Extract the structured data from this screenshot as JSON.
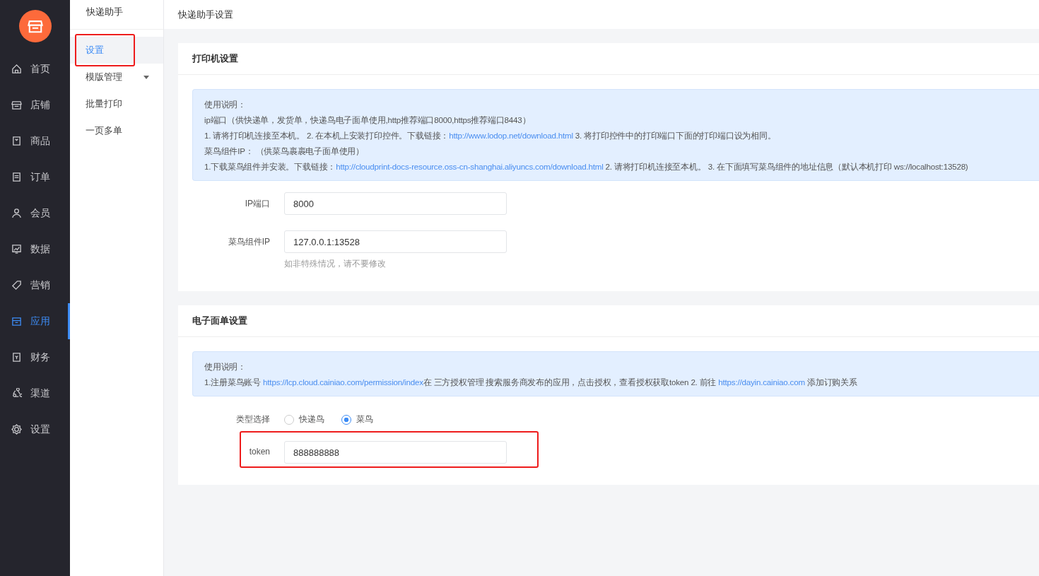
{
  "nav": [
    {
      "label": "首页",
      "selected": false
    },
    {
      "label": "店铺",
      "selected": false
    },
    {
      "label": "商品",
      "selected": false
    },
    {
      "label": "订单",
      "selected": false
    },
    {
      "label": "会员",
      "selected": false
    },
    {
      "label": "数据",
      "selected": false
    },
    {
      "label": "营销",
      "selected": false
    },
    {
      "label": "应用",
      "selected": true
    },
    {
      "label": "财务",
      "selected": false
    },
    {
      "label": "渠道",
      "selected": false
    },
    {
      "label": "设置",
      "selected": false
    }
  ],
  "submenu": {
    "title": "快递助手",
    "items": [
      {
        "label": "设置",
        "selected": true,
        "highlighted": true,
        "dropdown": false
      },
      {
        "label": "模版管理",
        "selected": false,
        "highlighted": false,
        "dropdown": true
      },
      {
        "label": "批量打印",
        "selected": false,
        "highlighted": false,
        "dropdown": false
      },
      {
        "label": "一页多单",
        "selected": false,
        "highlighted": false,
        "dropdown": false
      }
    ]
  },
  "page_title": "快递助手设置",
  "sections": [
    {
      "title": "打印机设置",
      "notes": [
        [
          {
            "text": "使用说明："
          }
        ],
        [
          {
            "text": "ip端口（供快递单，发货单，快递鸟电子面单使用,http推荐端口8000,https推荐端口8443）"
          }
        ],
        [
          {
            "text": "1. 请将打印机连接至本机。 2. 在本机上安装打印控件。下载链接："
          },
          {
            "text": "http://www.lodop.net/download.html",
            "link": true
          },
          {
            "text": " 3. 将打印控件中的打印端口下面的打印端口设为相同。"
          }
        ],
        [
          {
            "text": "菜鸟组件IP： （供菜鸟裹裹电子面单使用）"
          }
        ],
        [
          {
            "text": "1.下载菜鸟组件并安装。下载链接："
          },
          {
            "text": "http://cloudprint-docs-resource.oss-cn-shanghai.aliyuncs.com/download.html",
            "link": true
          },
          {
            "text": " 2. 请将打印机连接至本机。 3. 在下面填写菜鸟组件的地址信息（默认本机打印 ws://localhost:13528)"
          }
        ]
      ],
      "fields": [
        {
          "kind": "input",
          "label": "IP端口",
          "value": "8000",
          "highlighted": false
        },
        {
          "kind": "input",
          "label": "菜鸟组件IP",
          "value": "127.0.0.1:13528",
          "hint": "如非特殊情况，请不要修改",
          "highlighted": false
        }
      ]
    },
    {
      "title": "电子面单设置",
      "notes": [
        [
          {
            "text": "使用说明："
          }
        ],
        [
          {
            "text": "1.注册菜鸟账号 "
          },
          {
            "text": "https://lcp.cloud.cainiao.com/permission/index",
            "link": true
          },
          {
            "text": "在 三方授权管理 搜索服务商发布的应用，点击授权，查看授权获取token 2. 前往 "
          },
          {
            "text": "https://dayin.cainiao.com",
            "link": true
          },
          {
            "text": " 添加订购关系"
          }
        ]
      ],
      "fields": [
        {
          "kind": "radio",
          "label": "类型选择",
          "options": [
            {
              "label": "快递鸟",
              "selected": false
            },
            {
              "label": "菜鸟",
              "selected": true
            }
          ],
          "highlighted": false
        },
        {
          "kind": "input",
          "label": "token",
          "value": "888888888",
          "highlighted": true
        }
      ]
    }
  ]
}
